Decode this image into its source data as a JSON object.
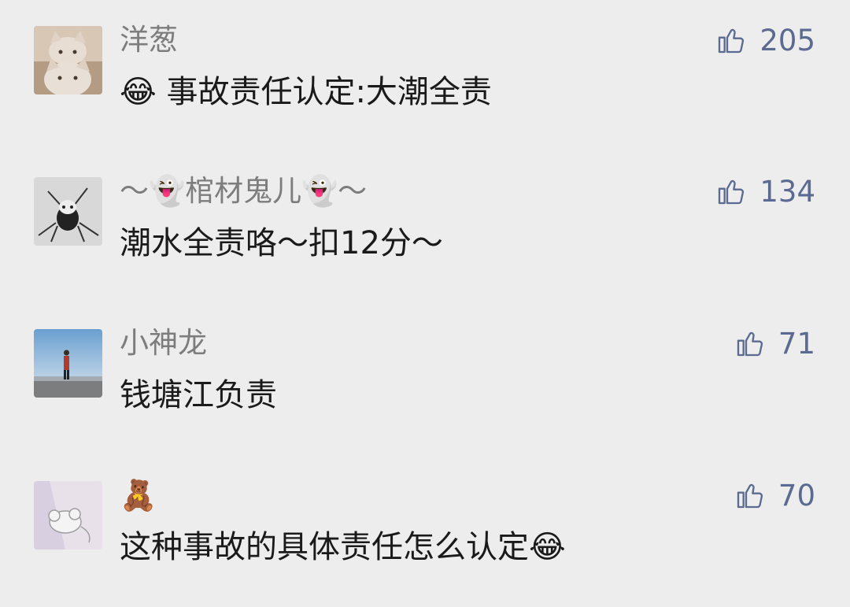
{
  "comments": [
    {
      "name": "洋葱",
      "text": "😂 事故责任认定:大潮全责",
      "likes": "205"
    },
    {
      "name": "〜👻棺材鬼儿👻〜",
      "text": "潮水全责咯〜扣12分〜",
      "likes": "134"
    },
    {
      "name": "小神龙",
      "text": "钱塘江负责",
      "likes": "71"
    },
    {
      "name": "🧸",
      "text": "这种事故的具体责任怎么认定😂",
      "likes": "70"
    }
  ],
  "colors": {
    "background": "#ededed",
    "name": "#7d7d7d",
    "text": "#1a1a1a",
    "like": "#5b6a91"
  },
  "icons": {
    "like": "thumbs-up-icon"
  }
}
